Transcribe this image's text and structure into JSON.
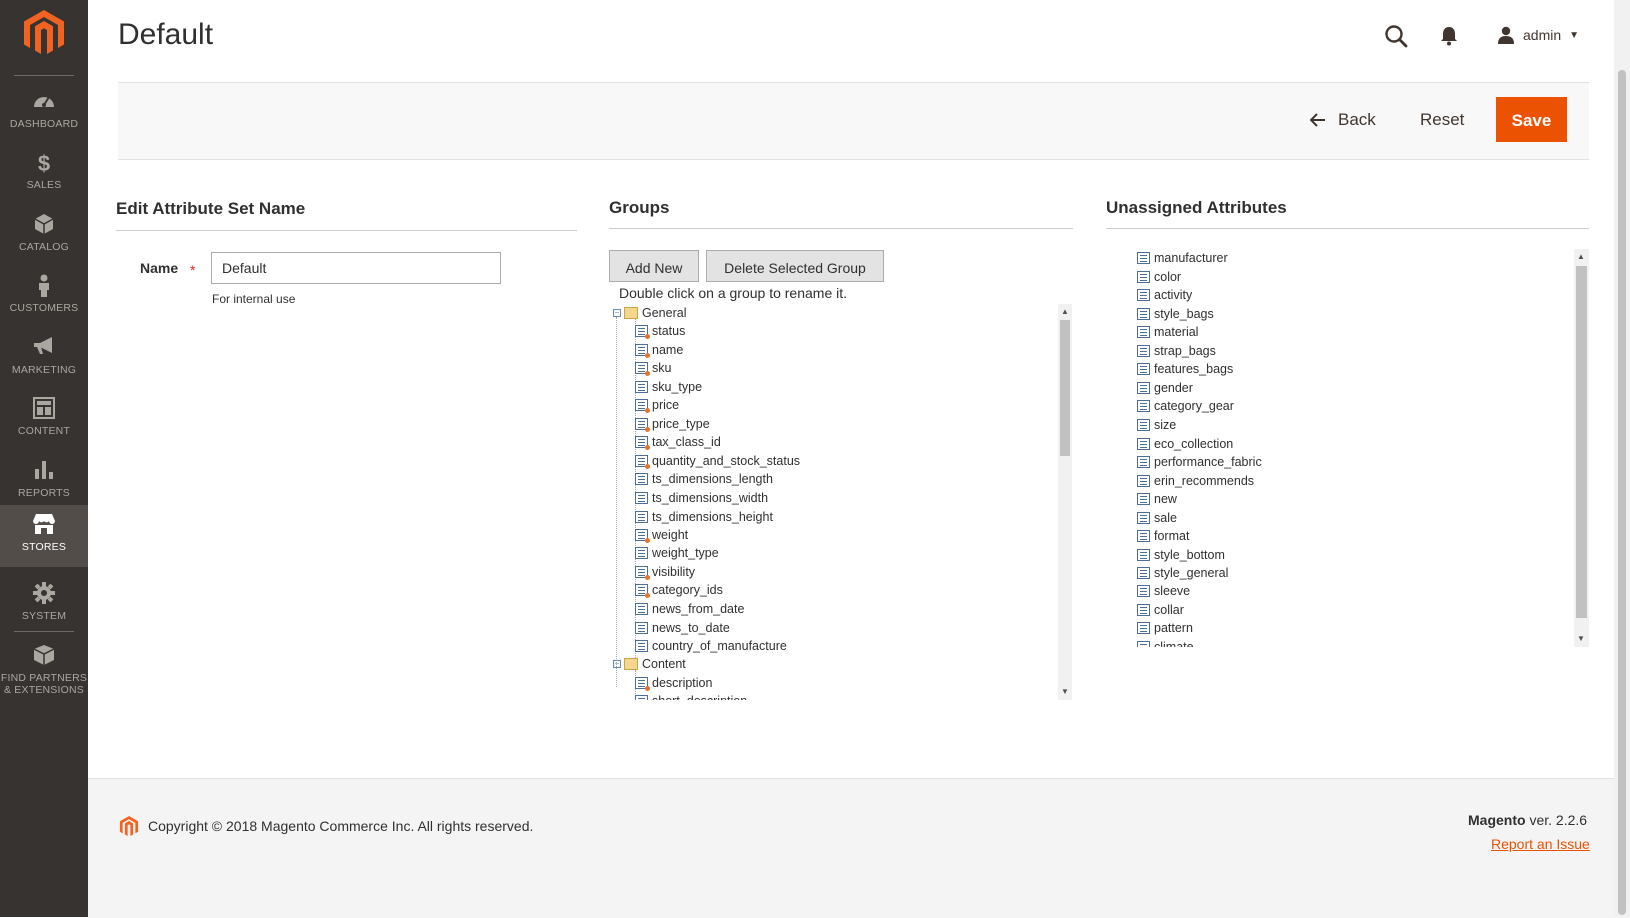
{
  "sidebar": {
    "items": [
      {
        "label": "DASHBOARD",
        "icon": "dashboard-icon"
      },
      {
        "label": "SALES",
        "icon": "dollar-icon"
      },
      {
        "label": "CATALOG",
        "icon": "cube-icon"
      },
      {
        "label": "CUSTOMERS",
        "icon": "person-icon"
      },
      {
        "label": "MARKETING",
        "icon": "megaphone-icon"
      },
      {
        "label": "CONTENT",
        "icon": "content-layout-icon"
      },
      {
        "label": "REPORTS",
        "icon": "bar-chart-icon"
      },
      {
        "label": "STORES",
        "icon": "store-icon",
        "active": true
      },
      {
        "label": "SYSTEM",
        "icon": "gear-icon"
      },
      {
        "label": "FIND PARTNERS & EXTENSIONS",
        "label_line1": "FIND PARTNERS",
        "label_line2": "& EXTENSIONS",
        "icon": "boxes-icon"
      }
    ]
  },
  "header": {
    "title": "Default",
    "user_name": "admin"
  },
  "actions": {
    "back_label": "Back",
    "reset_label": "Reset",
    "save_label": "Save"
  },
  "edit_section": {
    "title": "Edit Attribute Set Name",
    "name_label": "Name",
    "required_marker": "*",
    "name_value": "Default",
    "note": "For internal use"
  },
  "groups_section": {
    "title": "Groups",
    "add_new_label": "Add New",
    "delete_label": "Delete Selected Group",
    "hint": "Double click on a group to rename it.",
    "tree": [
      {
        "name": "General",
        "attributes": [
          {
            "name": "status",
            "system": true
          },
          {
            "name": "name",
            "system": true
          },
          {
            "name": "sku",
            "system": true
          },
          {
            "name": "sku_type",
            "system": false
          },
          {
            "name": "price",
            "system": true
          },
          {
            "name": "price_type",
            "system": true
          },
          {
            "name": "tax_class_id",
            "system": true
          },
          {
            "name": "quantity_and_stock_status",
            "system": true
          },
          {
            "name": "ts_dimensions_length",
            "system": false
          },
          {
            "name": "ts_dimensions_width",
            "system": false
          },
          {
            "name": "ts_dimensions_height",
            "system": false
          },
          {
            "name": "weight",
            "system": true
          },
          {
            "name": "weight_type",
            "system": false
          },
          {
            "name": "visibility",
            "system": true
          },
          {
            "name": "category_ids",
            "system": true
          },
          {
            "name": "news_from_date",
            "system": false
          },
          {
            "name": "news_to_date",
            "system": false
          },
          {
            "name": "country_of_manufacture",
            "system": false
          }
        ]
      },
      {
        "name": "Content",
        "attributes": [
          {
            "name": "description",
            "system": true
          },
          {
            "name": "short_description",
            "system": false
          }
        ]
      }
    ]
  },
  "unassigned_section": {
    "title": "Unassigned Attributes",
    "attributes": [
      "manufacturer",
      "color",
      "activity",
      "style_bags",
      "material",
      "strap_bags",
      "features_bags",
      "gender",
      "category_gear",
      "size",
      "eco_collection",
      "performance_fabric",
      "erin_recommends",
      "new",
      "sale",
      "format",
      "style_bottom",
      "style_general",
      "sleeve",
      "collar",
      "pattern",
      "climate"
    ]
  },
  "footer": {
    "copyright": "Copyright © 2018 Magento Commerce Inc. All rights reserved.",
    "brand": "Magento",
    "version": "ver. 2.2.6",
    "report_link": "Report an Issue"
  },
  "colors": {
    "sidebar_bg": "#373330",
    "sidebar_active": "#524d49",
    "accent": "#eb5202",
    "logo": "#f26322"
  }
}
